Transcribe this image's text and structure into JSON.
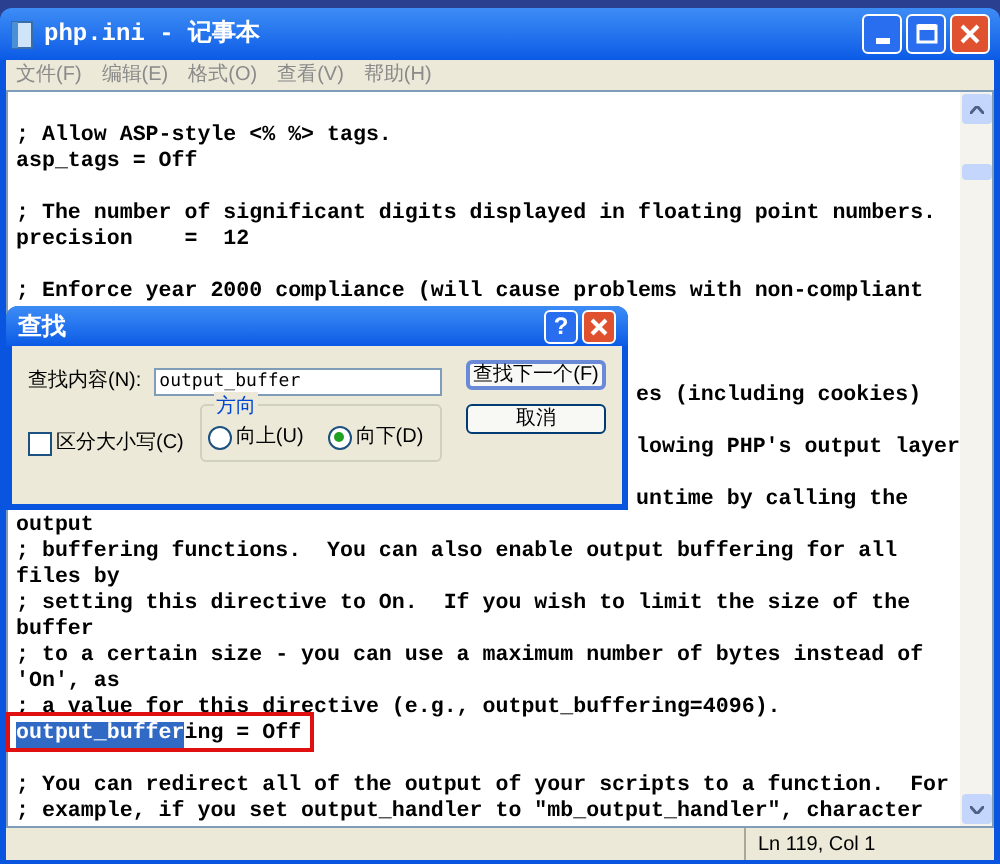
{
  "window": {
    "title": "php.ini - 记事本"
  },
  "menu": [
    "文件(F)",
    "编辑(E)",
    "格式(O)",
    "查看(V)",
    "帮助(H)"
  ],
  "lines": [
    {
      "kind": "blank"
    },
    {
      "kind": "text",
      "text": "; Allow ASP-style <% %> tags."
    },
    {
      "kind": "text",
      "text": "asp_tags = Off"
    },
    {
      "kind": "blank"
    },
    {
      "kind": "text",
      "text": "; The number of significant digits displayed in floating point numbers."
    },
    {
      "kind": "text",
      "text": "precision    =  12"
    },
    {
      "kind": "blank"
    },
    {
      "kind": "text",
      "text": "; Enforce year 2000 compliance (will cause problems with non-compliant"
    },
    {
      "kind": "blank"
    },
    {
      "kind": "blank"
    },
    {
      "kind": "blank"
    },
    {
      "kind": "tail",
      "text": "es (including cookies)"
    },
    {
      "kind": "blank"
    },
    {
      "kind": "tail",
      "text": "lowing PHP's output layer"
    },
    {
      "kind": "blank"
    },
    {
      "kind": "tail",
      "text": "untime by calling the"
    },
    {
      "kind": "text",
      "text": "output"
    },
    {
      "kind": "text",
      "text": "; buffering functions.  You can also enable output buffering for all"
    },
    {
      "kind": "text",
      "text": "files by"
    },
    {
      "kind": "text",
      "text": "; setting this directive to On.  If you wish to limit the size of the"
    },
    {
      "kind": "text",
      "text": "buffer"
    },
    {
      "kind": "text",
      "text": "; to a certain size - you can use a maximum number of bytes instead of"
    },
    {
      "kind": "text",
      "text": "'On', as"
    },
    {
      "kind": "text",
      "text": "; a value for this directive (e.g., output_buffering=4096)."
    },
    {
      "kind": "match",
      "selected_text": "output_buffer",
      "text": "ing = Off"
    },
    {
      "kind": "blank"
    },
    {
      "kind": "text",
      "text": "; You can redirect all of the output of your scripts to a function.  For"
    },
    {
      "kind": "text",
      "text": "; example, if you set output_handler to \"mb_output_handler\", character"
    }
  ],
  "status_bar": {
    "position": "Ln 119, Col 1"
  },
  "find_dialog": {
    "title": "查找",
    "help": "?",
    "find_label": "查找内容(N):",
    "find_value": "output_buffer",
    "buttons": [
      "查找下一个(F)",
      "取消"
    ],
    "match_case": {
      "label": "区分大小写(C)",
      "checked": false
    },
    "direction": {
      "label": "方向",
      "options": [
        {
          "label": "向上(U)",
          "selected": false
        },
        {
          "label": "向下(D)",
          "selected": true
        }
      ]
    }
  }
}
